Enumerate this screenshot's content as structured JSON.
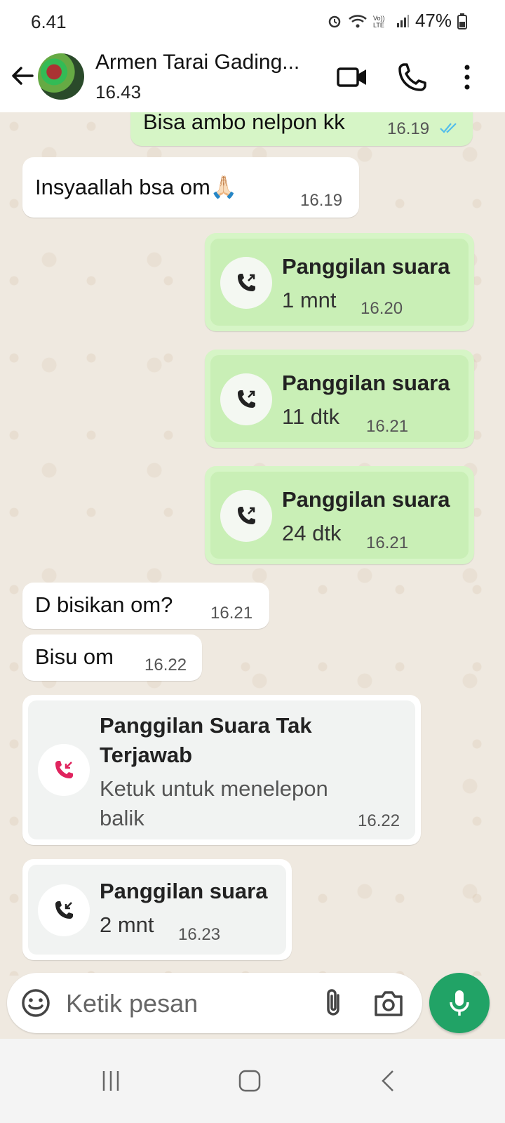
{
  "status_bar": {
    "time": "6.41",
    "battery": "47%"
  },
  "header": {
    "contact_name": "Armen Tarai Gading...",
    "last_seen": "16.43"
  },
  "messages": [
    {
      "text": "Bisa ambo nelpon kk",
      "time": "16.19"
    },
    {
      "text": "Insyaallah  bsa om🙏🏻",
      "time": "16.19"
    }
  ],
  "calls_outgoing": [
    {
      "title": "Panggilan suara",
      "duration": "1 mnt",
      "time": "16.20"
    },
    {
      "title": "Panggilan suara",
      "duration": "11 dtk",
      "time": "16.21"
    },
    {
      "title": "Panggilan suara",
      "duration": "24 dtk",
      "time": "16.21"
    }
  ],
  "messages2": [
    {
      "text": "D bisikan om?",
      "time": "16.21"
    },
    {
      "text": "Bisu om",
      "time": "16.22"
    }
  ],
  "missed_call": {
    "title_line1": "Panggilan Suara Tak",
    "title_line2": "Terjawab",
    "sub_line1": "Ketuk untuk menelepon",
    "sub_line2": "balik",
    "time": "16.22"
  },
  "incoming_call": {
    "title": "Panggilan suara",
    "duration": "2 mnt",
    "time": "16.23"
  },
  "composer": {
    "placeholder": "Ketik pesan"
  },
  "colors": {
    "outgoing_bubble": "#d6f5c6",
    "incoming_bubble": "#ffffff",
    "missed_call_red": "#e0245e",
    "mic_green": "#21a366",
    "read_ticks": "#53bdeb"
  }
}
